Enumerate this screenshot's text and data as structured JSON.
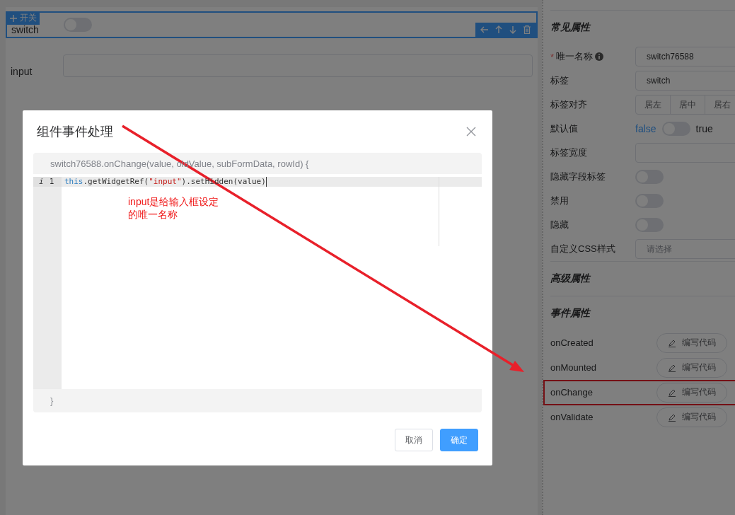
{
  "canvas": {
    "widgets": [
      {
        "kind": "switch",
        "label": "switch",
        "on": false,
        "selected": true,
        "tag": "开关"
      },
      {
        "kind": "input",
        "label": "input",
        "selected": false
      }
    ]
  },
  "panel": {
    "sections": [
      {
        "title": "常见属性",
        "rows": [
          {
            "kind": "text-input",
            "label": "唯一名称",
            "required_mark": "*",
            "info": true,
            "value": "switch76588"
          },
          {
            "kind": "text-input",
            "label": "标签",
            "value": "switch"
          },
          {
            "kind": "radio-group",
            "label": "标签对齐",
            "options": [
              {
                "label": "居左",
                "selected": false
              },
              {
                "label": "居中",
                "selected": false
              },
              {
                "label": "居右",
                "selected": false
              }
            ]
          },
          {
            "kind": "bool-switch",
            "label": "默认值",
            "false_label": "false",
            "true_label": "true",
            "on": false
          },
          {
            "kind": "text-input",
            "label": "标签宽度"
          },
          {
            "kind": "switch",
            "label": "隐藏字段标签",
            "on": false
          },
          {
            "kind": "switch",
            "label": "禁用",
            "on": false
          },
          {
            "kind": "switch",
            "label": "隐藏",
            "on": false
          },
          {
            "kind": "select",
            "label": "自定义CSS样式",
            "placeholder": "请选择"
          }
        ]
      },
      {
        "title": "高级属性"
      },
      {
        "title": "事件属性",
        "rows": [
          {
            "kind": "event",
            "label": "onCreated",
            "button": "编写代码",
            "highlighted": false
          },
          {
            "kind": "event",
            "label": "onMounted",
            "button": "编写代码",
            "highlighted": false
          },
          {
            "kind": "event",
            "label": "onChange",
            "button": "编写代码",
            "highlighted": true
          },
          {
            "kind": "event",
            "label": "onValidate",
            "button": "编写代码",
            "highlighted": false
          }
        ]
      }
    ]
  },
  "dialog": {
    "title": "组件事件处理",
    "signature": "switch76588.onChange(value, oldValue, subFormData, rowId) {",
    "lines": [
      {
        "marker": "i",
        "number": "1",
        "tokens": [
          {
            "kind": "keyword",
            "text": "this"
          },
          {
            "kind": "plain",
            "text": ".getWidgetRef("
          },
          {
            "kind": "string",
            "text": "\"input\""
          },
          {
            "kind": "plain",
            "text": ").setHidden(value)"
          }
        ]
      }
    ],
    "closing": "}",
    "buttons": [
      {
        "kind": "secondary",
        "label": "取消"
      },
      {
        "kind": "primary",
        "label": "确定"
      }
    ]
  },
  "annotation": {
    "note_lines": [
      "input是给输入框设定",
      "的唯一名称"
    ]
  }
}
